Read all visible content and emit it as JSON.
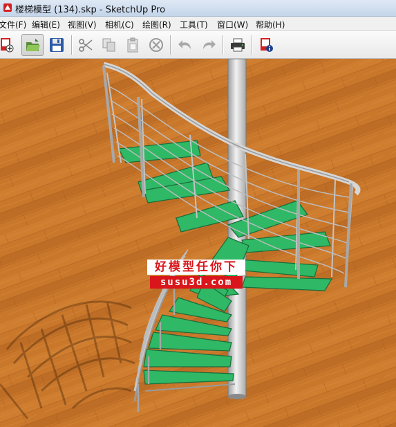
{
  "window": {
    "title": "楼梯模型 (134).skp - SketchUp Pro"
  },
  "menubar": {
    "items": [
      {
        "label": "文件(F)"
      },
      {
        "label": "编辑(E)"
      },
      {
        "label": "视图(V)"
      },
      {
        "label": "相机(C)"
      },
      {
        "label": "绘图(R)"
      },
      {
        "label": "工具(T)"
      },
      {
        "label": "窗口(W)"
      },
      {
        "label": "帮助(H)"
      }
    ]
  },
  "toolbar": {
    "buttons": [
      {
        "icon": "new-icon"
      },
      {
        "icon": "open-icon",
        "pressed": true
      },
      {
        "icon": "save-icon"
      },
      {
        "icon": "cut-icon"
      },
      {
        "icon": "copy-icon"
      },
      {
        "icon": "paste-icon"
      },
      {
        "icon": "erase-icon"
      },
      {
        "icon": "undo-icon"
      },
      {
        "icon": "redo-icon"
      },
      {
        "icon": "print-icon"
      },
      {
        "icon": "model-info-icon"
      }
    ]
  },
  "viewport": {
    "floor_color": "#c9772b",
    "tread_color": "#2fb865",
    "rail_color": "#c8c8c8"
  },
  "watermark": {
    "line1": "好模型任你下",
    "line2": "susu3d.com"
  }
}
